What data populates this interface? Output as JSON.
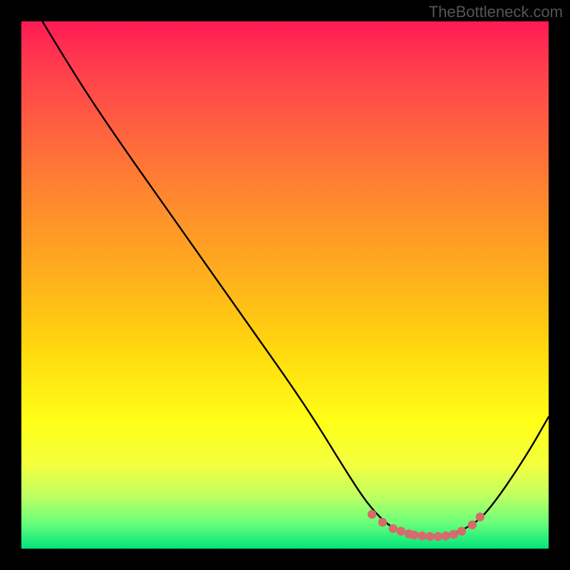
{
  "watermark": "TheBottleneck.com",
  "chart_data": {
    "type": "line",
    "title": "",
    "xlabel": "",
    "ylabel": "",
    "xlim": [
      0,
      1
    ],
    "ylim": [
      0,
      1
    ],
    "curve": [
      {
        "x": 0.04,
        "y": 1.0
      },
      {
        "x": 0.1,
        "y": 0.9
      },
      {
        "x": 0.18,
        "y": 0.78
      },
      {
        "x": 0.3,
        "y": 0.61
      },
      {
        "x": 0.42,
        "y": 0.44
      },
      {
        "x": 0.54,
        "y": 0.27
      },
      {
        "x": 0.62,
        "y": 0.14
      },
      {
        "x": 0.66,
        "y": 0.08
      },
      {
        "x": 0.7,
        "y": 0.04
      },
      {
        "x": 0.74,
        "y": 0.025
      },
      {
        "x": 0.8,
        "y": 0.022
      },
      {
        "x": 0.86,
        "y": 0.045
      },
      {
        "x": 0.9,
        "y": 0.09
      },
      {
        "x": 0.96,
        "y": 0.18
      },
      {
        "x": 1.0,
        "y": 0.25
      }
    ],
    "highlight_points": [
      {
        "x": 0.665,
        "y": 0.065
      },
      {
        "x": 0.685,
        "y": 0.05
      },
      {
        "x": 0.705,
        "y": 0.038
      },
      {
        "x": 0.72,
        "y": 0.033
      },
      {
        "x": 0.735,
        "y": 0.028
      },
      {
        "x": 0.745,
        "y": 0.026
      },
      {
        "x": 0.76,
        "y": 0.024
      },
      {
        "x": 0.775,
        "y": 0.023
      },
      {
        "x": 0.79,
        "y": 0.023
      },
      {
        "x": 0.805,
        "y": 0.024
      },
      {
        "x": 0.82,
        "y": 0.027
      },
      {
        "x": 0.835,
        "y": 0.033
      },
      {
        "x": 0.855,
        "y": 0.045
      },
      {
        "x": 0.87,
        "y": 0.06
      }
    ],
    "highlight_color": "#d76a6a",
    "curve_color": "#000000"
  }
}
